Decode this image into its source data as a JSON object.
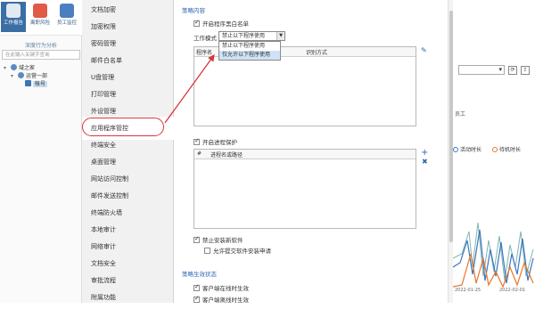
{
  "toolbar": {
    "buttons": [
      {
        "label": "工作报告",
        "icon": "report-icon",
        "active": true
      },
      {
        "label": "离职风险",
        "icon": "risk-icon",
        "active": false
      },
      {
        "label": "员工监控",
        "icon": "monitor-icon",
        "active": false
      }
    ],
    "behavior_label": "深度行为分析"
  },
  "tree": {
    "search_placeholder": "在此输入关键字查询",
    "nodes": [
      {
        "label": "域之家",
        "level": 0,
        "toggle": "▾"
      },
      {
        "label": "运营一部",
        "level": 1,
        "toggle": "▾"
      },
      {
        "label": "帐号",
        "level": 2,
        "toggle": "",
        "selected": true
      }
    ]
  },
  "nav": {
    "items": [
      "文档加密",
      "加密权限",
      "密码管理",
      "邮件白名单",
      "U盘管理",
      "打印管理",
      "外设管理",
      "应用程序管控",
      "终端安全",
      "桌面管理",
      "网站访问控制",
      "邮件发送控制",
      "终端防火墙",
      "本地审计",
      "网络审计",
      "文档安全",
      "审批流程",
      "附属功能"
    ],
    "active_index": 7
  },
  "panel": {
    "section1_title": "策略内容",
    "whitelist_checkbox": "开启程序黑白名单",
    "mode_label": "工作模式",
    "mode_value": "禁止以下程序使用",
    "mode_options": [
      "禁止以下程序使用",
      "仅允许以下程序使用"
    ],
    "mode_highlight_index": 1,
    "grid1_col1": "程序名",
    "grid1_col2": "识别方式",
    "process_protect_checkbox": "开启进程保护",
    "grid2_col1": "#",
    "grid2_col2": "进程名或路径",
    "forbid_install_checkbox": "禁止安装新软件",
    "allow_submit_checkbox": "允许提交软件安装申请",
    "section2_title": "策略生效状态",
    "online_effective_checkbox": "客户端在线时生效",
    "offline_effective_checkbox": "客户端离线时生效"
  },
  "right_panel": {
    "label_fragment": "员工",
    "legend": [
      {
        "label": "活动时长",
        "color": "#3a78c2"
      },
      {
        "label": "待机时长",
        "color": "#e8752a"
      }
    ],
    "axis_labels": [
      "2022-01-25",
      "2022-02-01"
    ]
  },
  "colors": {
    "accent_blue": "#2f67b1",
    "toolbar_active": "#3b6ea5",
    "annotation_red": "#d9363e",
    "series_blue": "#3a78c2",
    "series_orange": "#e8752a",
    "series_green": "#7fb5b0"
  }
}
